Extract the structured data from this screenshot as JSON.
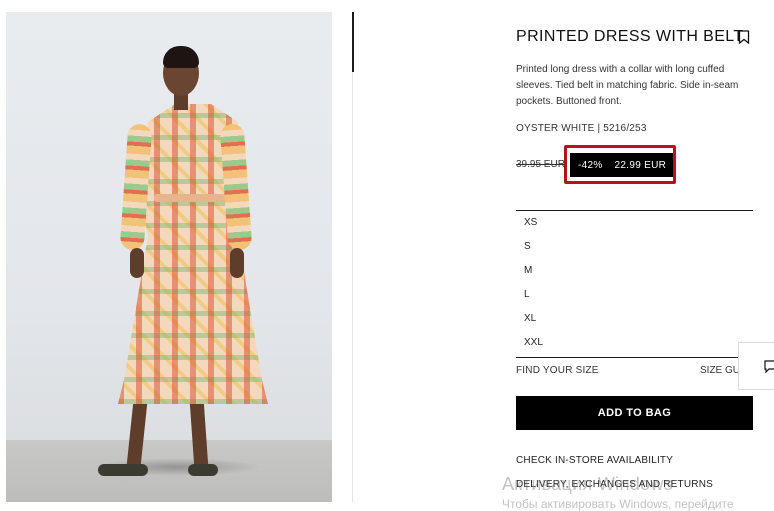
{
  "product": {
    "title": "PRINTED DRESS WITH BELT",
    "description": "Printed long dress with a collar with long cuffed sleeves. Tied belt in matching fabric. Side in-seam pockets. Buttoned front.",
    "color_ref": "OYSTER WHITE | 5216/253",
    "old_price": "39.95 EUR",
    "discount": "-42%",
    "price": "22.99 EUR"
  },
  "sizes": [
    "XS",
    "S",
    "M",
    "L",
    "XL",
    "XXL"
  ],
  "size_help": {
    "find_size": "FIND YOUR SIZE",
    "size_guide": "SIZE GUIDE"
  },
  "actions": {
    "add_to_bag": "ADD TO BAG",
    "check_store": "CHECK IN-STORE AVAILABILITY",
    "delivery": "DELIVERY, EXCHANGES AND RETURNS"
  },
  "watermark": {
    "line1": "Активация Windows",
    "line2": "Чтобы активировать Windows, перейдите"
  },
  "icons": {
    "bookmark": "bookmark-icon",
    "chat": "chat-icon"
  },
  "colors": {
    "accent": "#000000",
    "highlight": "#b3121f"
  }
}
